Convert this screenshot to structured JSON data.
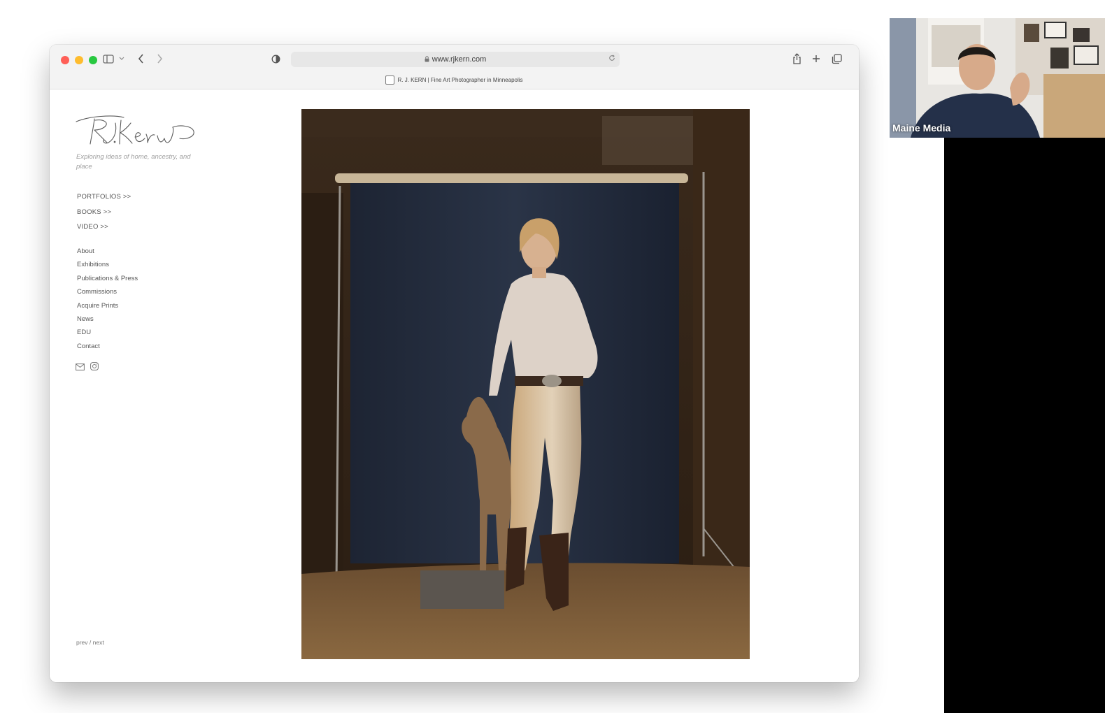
{
  "browser": {
    "url": "www.rjkern.com",
    "tab_title": "R. J. KERN | Fine Art Photographer in Minneapolis"
  },
  "site": {
    "tagline": "Exploring ideas of home, ancestry, and place",
    "nav_primary": [
      "PORTFOLIOS >>",
      "BOOKS >>",
      "VIDEO >>"
    ],
    "nav_secondary": [
      "About",
      "Exhibitions",
      "Publications & Press",
      "Commissions",
      "Acquire Prints",
      "News",
      "EDU",
      "Contact"
    ],
    "prev_label": "prev",
    "separator": "/",
    "next_label": "next"
  },
  "video_call": {
    "participant_name": "Maine Media"
  },
  "colors": {
    "close": "#ff5f57",
    "minimize": "#febc2e",
    "zoom": "#28c840"
  },
  "icons": [
    "sidebar-icon",
    "chevron-down-icon",
    "back-icon",
    "forward-icon",
    "privacy-shield-icon",
    "lock-icon",
    "reload-icon",
    "share-icon",
    "new-tab-icon",
    "tab-overview-icon",
    "email-icon",
    "instagram-icon"
  ]
}
